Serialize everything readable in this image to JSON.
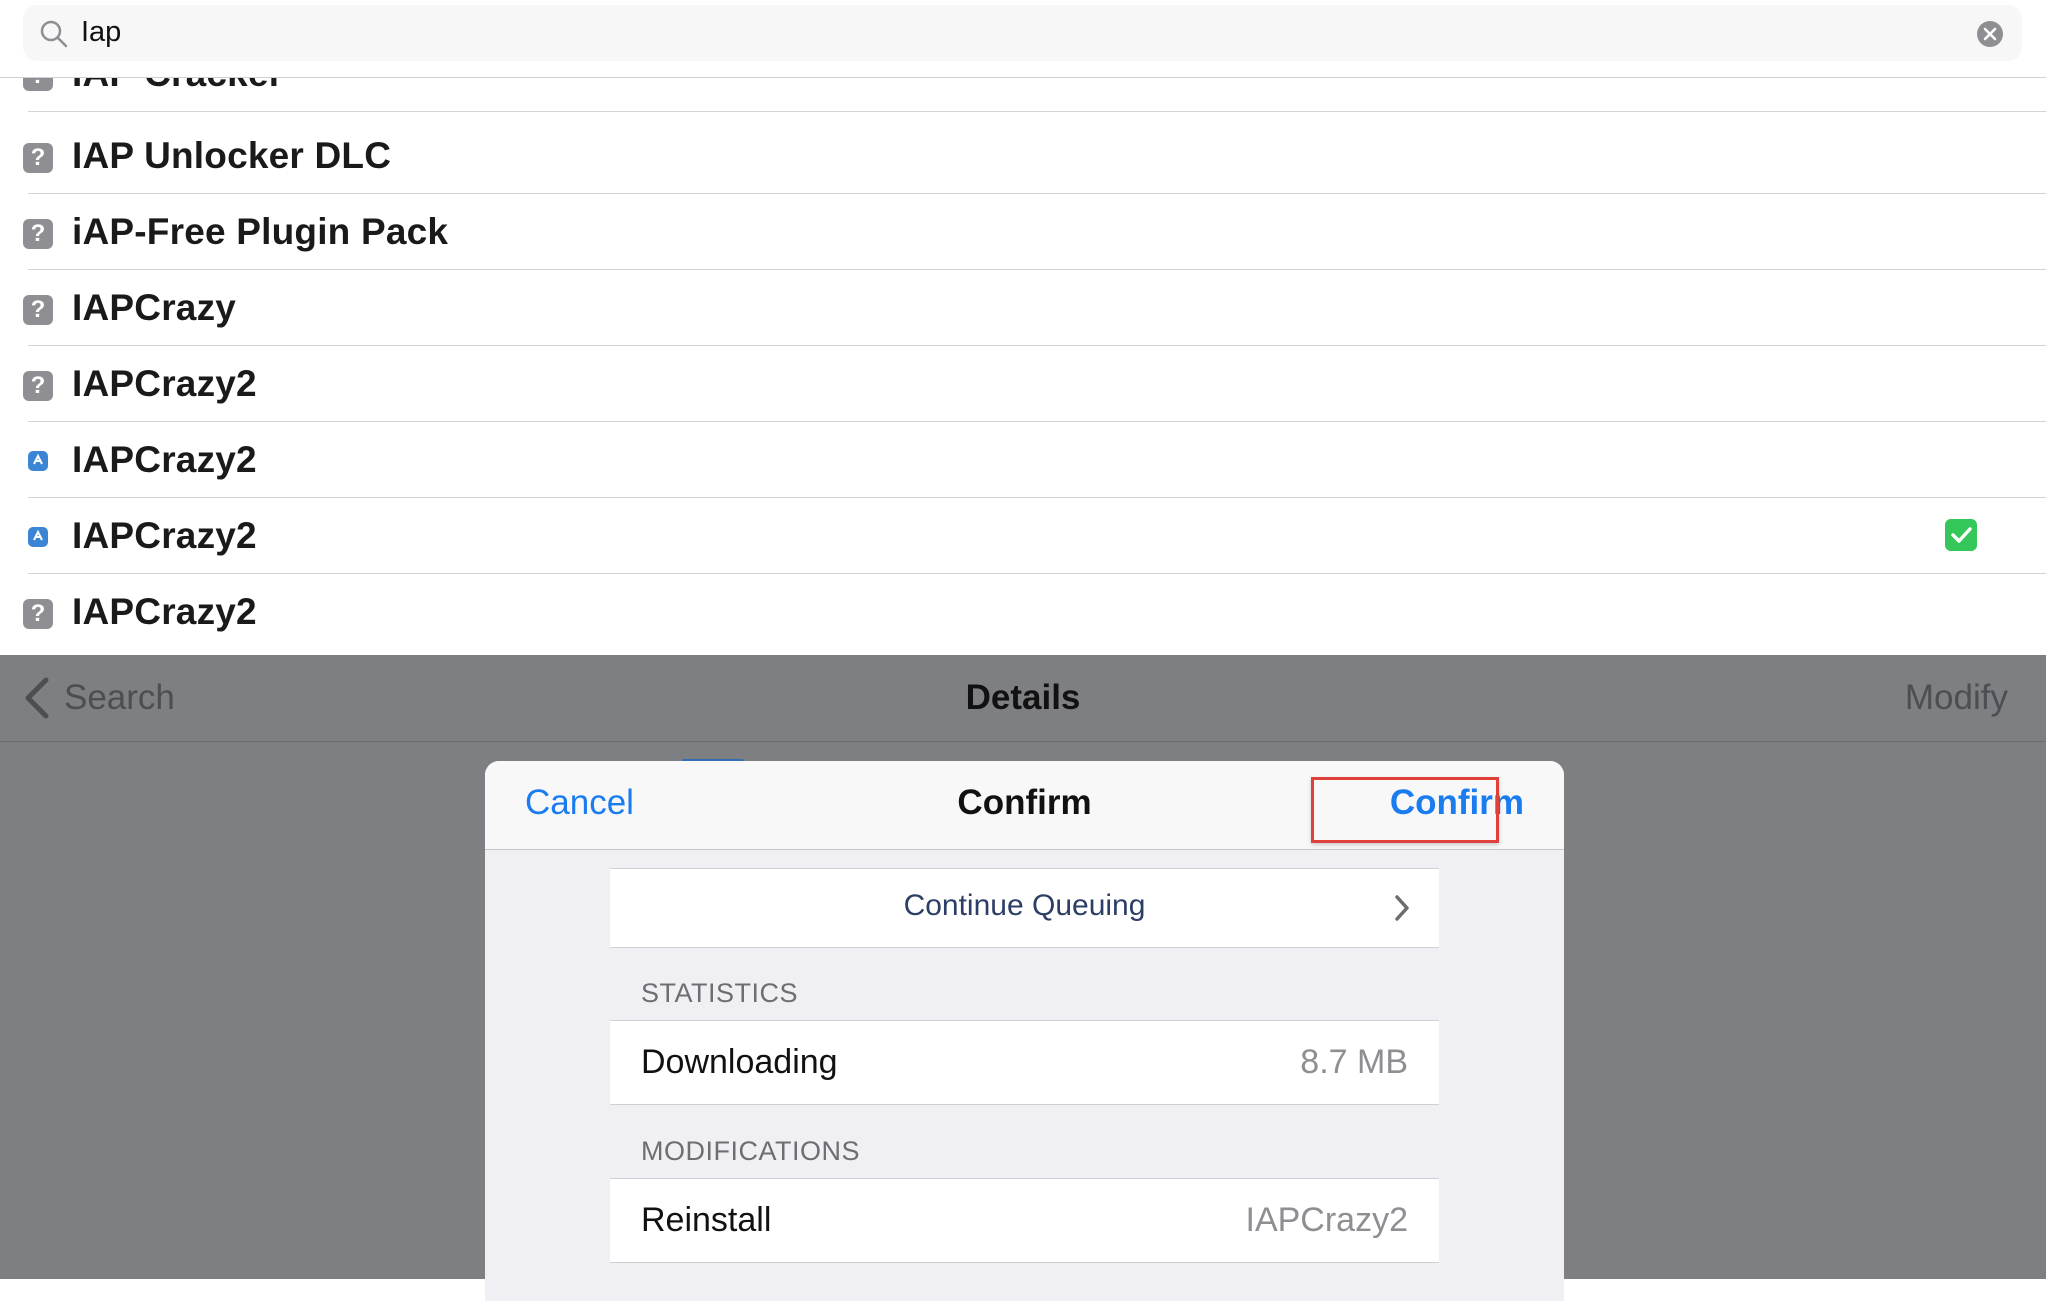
{
  "search": {
    "query": "Iap"
  },
  "results": [
    {
      "name": "IAP Cracker",
      "icon": "question-icon",
      "checked": false
    },
    {
      "name": "IAP Unlocker DLC",
      "icon": "question-icon",
      "checked": false
    },
    {
      "name": "iAP-Free Plugin Pack",
      "icon": "question-icon",
      "checked": false
    },
    {
      "name": "IAPCrazy",
      "icon": "question-icon",
      "checked": false
    },
    {
      "name": "IAPCrazy2",
      "icon": "question-icon",
      "checked": false
    },
    {
      "name": "IAPCrazy2",
      "icon": "repo-app-icon",
      "checked": false
    },
    {
      "name": "IAPCrazy2",
      "icon": "repo-app-icon",
      "checked": true
    },
    {
      "name": "IAPCrazy2",
      "icon": "question-icon",
      "checked": false
    }
  ],
  "nav": {
    "back_label": "Search",
    "title": "Details",
    "right_label": "Modify"
  },
  "modal": {
    "cancel_label": "Cancel",
    "title": "Confirm",
    "confirm_label": "Confirm",
    "continue_label": "Continue Queuing",
    "statistics_header": "STATISTICS",
    "downloading_label": "Downloading",
    "downloading_value": "8.7 MB",
    "modifications_header": "MODIFICATIONS",
    "reinstall_label": "Reinstall",
    "reinstall_value": "IAPCrazy2"
  },
  "colors": {
    "accent": "#1b7cf0",
    "check": "#35c759",
    "highlight": "#e0403a",
    "dim": "#7e7f83"
  }
}
